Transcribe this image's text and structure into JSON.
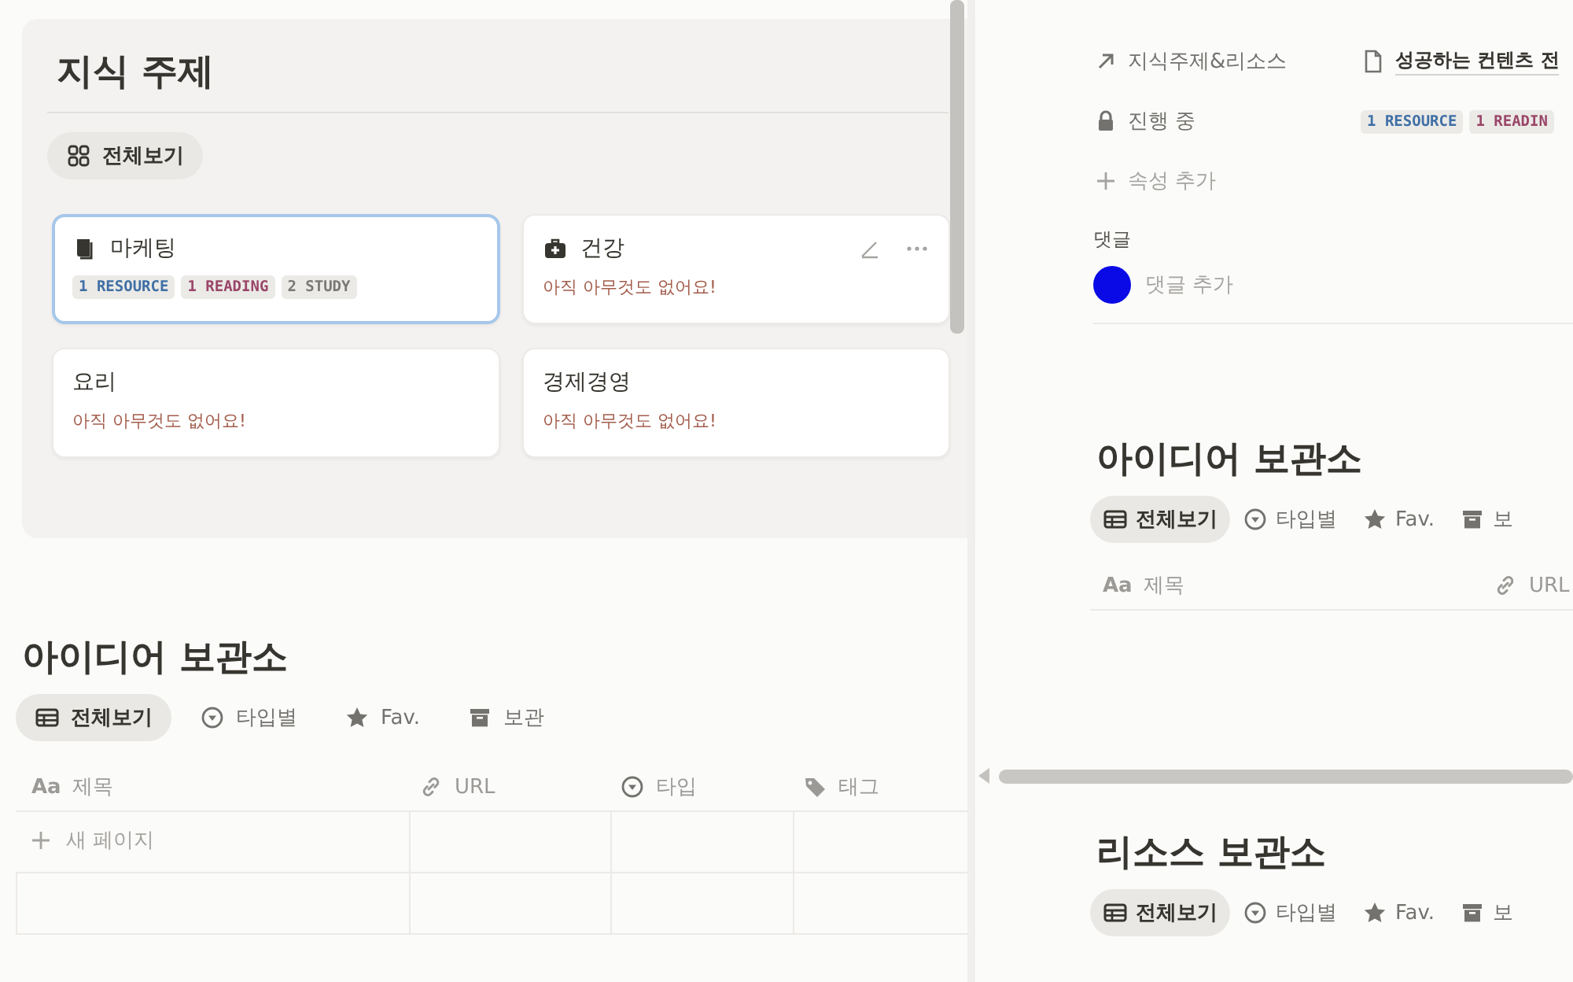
{
  "knowledge": {
    "title": "지식 주제",
    "views": [
      {
        "label": "전체보기",
        "selected": true
      }
    ],
    "cards": [
      {
        "title": "마케팅",
        "selected": true,
        "actions": false,
        "tags": [
          {
            "label": "1 RESOURCE",
            "color": "#3f6fa5"
          },
          {
            "label": "1 READING",
            "color": "#9a4668"
          },
          {
            "label": "2 STUDY",
            "color": "#7a7874"
          }
        ]
      },
      {
        "title": "건강",
        "selected": false,
        "actions": true,
        "empty": "아직 아무것도 없어요!"
      },
      {
        "title": "요리",
        "selected": false,
        "actions": false,
        "empty": "아직 아무것도 없어요!"
      },
      {
        "title": "경제경영",
        "selected": false,
        "actions": false,
        "empty": "아직 아무것도 없어요!"
      }
    ]
  },
  "ideas": {
    "title": "아이디어 보관소",
    "views": [
      {
        "label": "전체보기",
        "selected": true
      },
      {
        "label": "타입별",
        "selected": false
      },
      {
        "label": "Fav.",
        "selected": false
      },
      {
        "label": "보관",
        "selected": false
      }
    ],
    "columns": [
      {
        "label": "제목",
        "prefix": "Aa"
      },
      {
        "label": "URL"
      },
      {
        "label": "타입"
      },
      {
        "label": "태그"
      }
    ],
    "new_page": "새 페이지"
  },
  "detail": {
    "properties": [
      {
        "label": "지식주제&리소스",
        "value": "성공하는 컨텐츠 전"
      },
      {
        "label": "진행 중",
        "tags": [
          {
            "label": "1 RESOURCE",
            "color": "#3f6fa5"
          },
          {
            "label": "1 READIN",
            "color": "#9a4668"
          }
        ]
      }
    ],
    "add_property": "속성 추가",
    "comments_label": "댓글",
    "add_comment": "댓글 추가",
    "ideas": {
      "title": "아이디어 보관소",
      "views": [
        {
          "label": "전체보기",
          "selected": true
        },
        {
          "label": "타입별",
          "selected": false
        },
        {
          "label": "Fav.",
          "selected": false
        },
        {
          "label": "보",
          "selected": false
        }
      ],
      "columns": [
        {
          "label": "제목",
          "prefix": "Aa"
        },
        {
          "label": "URL"
        }
      ]
    },
    "resources": {
      "title": "리소스 보관소",
      "views": [
        {
          "label": "전체보기",
          "selected": true
        },
        {
          "label": "타입별",
          "selected": false
        },
        {
          "label": "Fav.",
          "selected": false
        },
        {
          "label": "보",
          "selected": false
        }
      ]
    }
  }
}
